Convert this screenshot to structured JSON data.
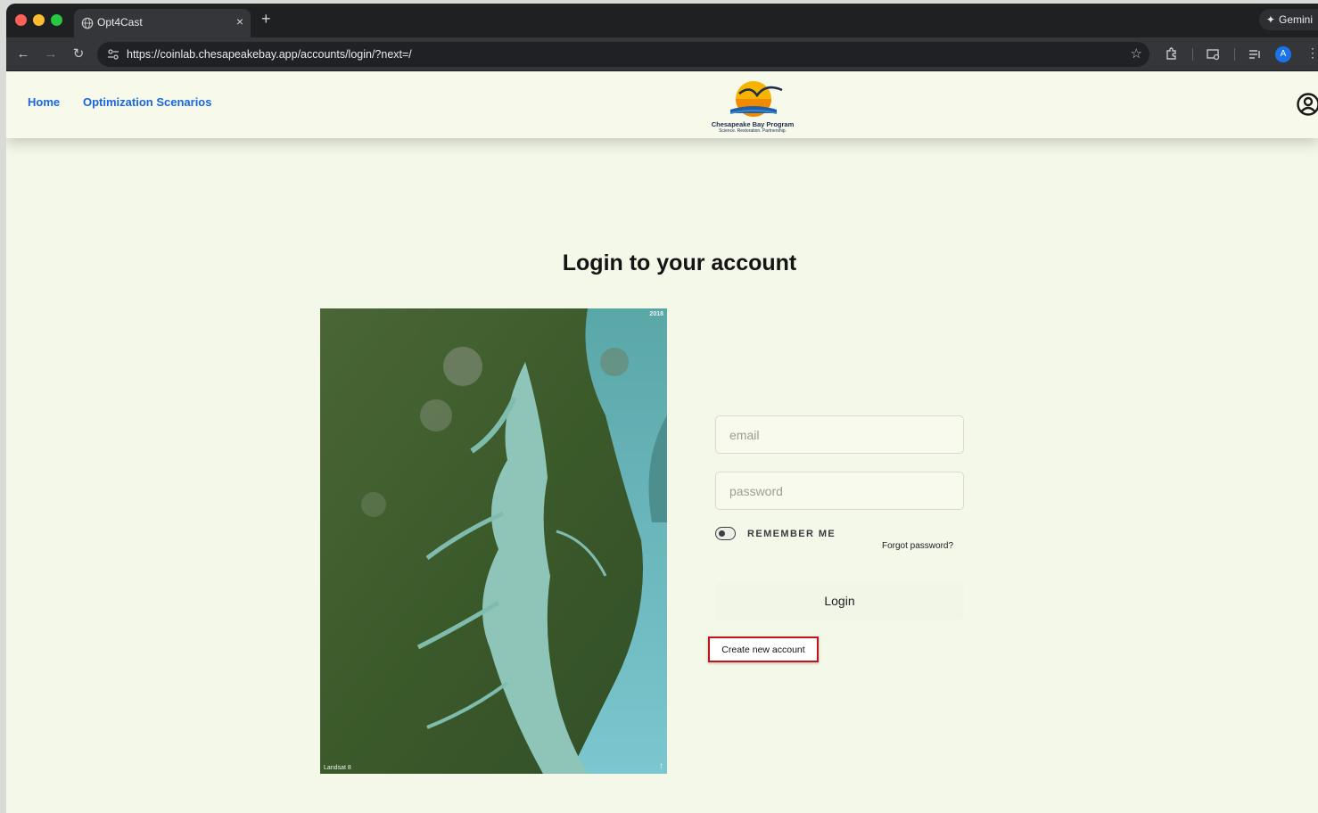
{
  "browser": {
    "tab_title": "Opt4Cast",
    "tab_close_glyph": "×",
    "new_tab_glyph": "+",
    "gemini_label": "Gemini",
    "url": "https://coinlab.chesapeakebay.app/accounts/login/?next=/",
    "profile_initial": "A"
  },
  "header": {
    "nav": {
      "home": "Home",
      "scenarios": "Optimization Scenarios"
    },
    "logo": {
      "title": "Chesapeake Bay Program",
      "tagline": "Science. Restoration. Partnership."
    }
  },
  "main": {
    "heading": "Login to your account",
    "map": {
      "year": "2018",
      "credit": "Landsat 8"
    },
    "form": {
      "email_placeholder": "email",
      "password_placeholder": "password",
      "remember_label": "REMEMBER ME",
      "forgot_label": "Forgot password?",
      "login_label": "Login",
      "create_label": "Create new account"
    }
  },
  "colors": {
    "link": "#1a66e0",
    "highlight_border": "#c4121d",
    "page_background": "#f4f8e8"
  }
}
